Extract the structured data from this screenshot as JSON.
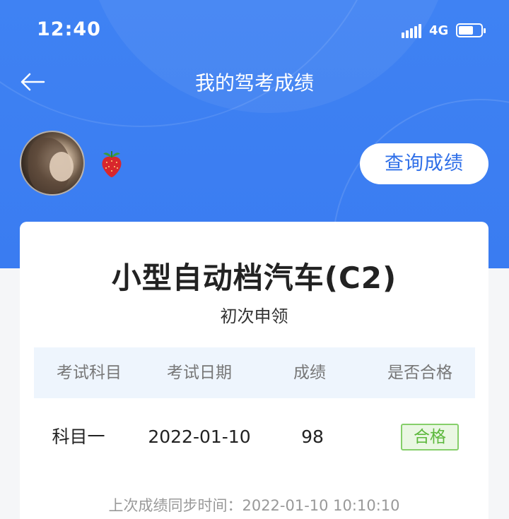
{
  "status_bar": {
    "time": "12:40",
    "network": "4G",
    "icons": [
      "signal-icon",
      "battery-icon"
    ]
  },
  "nav": {
    "title": "我的驾考成绩",
    "back_icon": "arrow-left-icon"
  },
  "profile": {
    "decoration_icon": "strawberry-icon",
    "query_button_label": "查询成绩"
  },
  "card": {
    "license_title": "小型自动档汽车(C2)",
    "apply_type": "初次申领",
    "columns": [
      "考试科目",
      "考试日期",
      "成绩",
      "是否合格"
    ],
    "rows": [
      {
        "subject": "科目一",
        "date": "2022-01-10",
        "score": "98",
        "result": "合格"
      }
    ],
    "sync_label": "上次成绩同步时间：",
    "sync_time": "2022-01-10 10:10:10"
  },
  "colors": {
    "header_blue": "#3f82f3",
    "pass_green": "#5cb83c",
    "query_text_blue": "#2f6fe8"
  }
}
